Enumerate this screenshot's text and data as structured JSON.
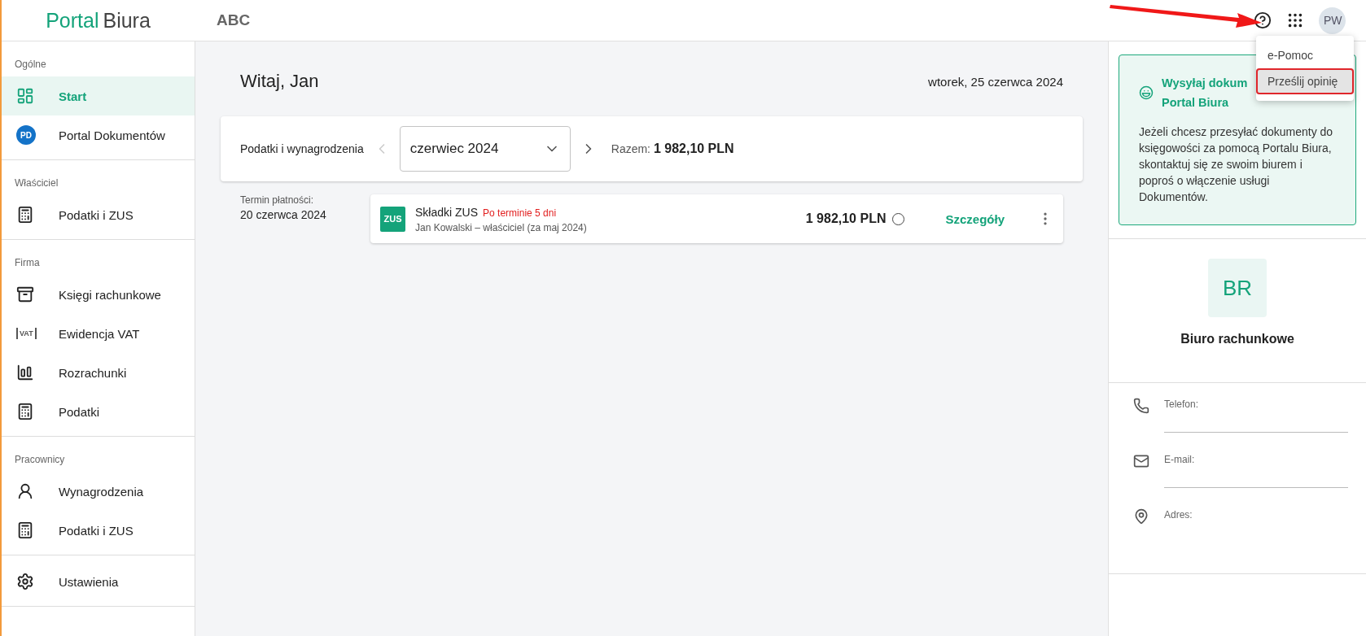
{
  "header": {
    "logo": {
      "part1": "Portal",
      "part2": "Biura"
    },
    "company": "ABC",
    "avatar": "PW"
  },
  "help_menu": {
    "items": [
      {
        "label": "e-Pomoc",
        "selected": false
      },
      {
        "label": "Prześlij opinię",
        "selected": true
      }
    ]
  },
  "sidebar": {
    "sections": [
      {
        "title": "Ogólne",
        "items": [
          {
            "label": "Start",
            "selected": true,
            "kind": "icon"
          },
          {
            "label": "Portal Dokumentów",
            "selected": false,
            "kind": "badge",
            "badge": "PD"
          }
        ]
      },
      {
        "title": "Właściciel",
        "items": [
          {
            "label": "Podatki i ZUS",
            "selected": false,
            "kind": "icon"
          }
        ]
      },
      {
        "title": "Firma",
        "items": [
          {
            "label": "Księgi rachunkowe",
            "selected": false,
            "kind": "icon"
          },
          {
            "label": "Ewidencja VAT",
            "selected": false,
            "kind": "tag",
            "badge": "VAT"
          },
          {
            "label": "Rozrachunki",
            "selected": false,
            "kind": "icon"
          },
          {
            "label": "Podatki",
            "selected": false,
            "kind": "icon"
          }
        ]
      },
      {
        "title": "Pracownicy",
        "items": [
          {
            "label": "Wynagrodzenia",
            "selected": false,
            "kind": "icon"
          },
          {
            "label": "Podatki i ZUS",
            "selected": false,
            "kind": "icon"
          }
        ]
      },
      {
        "items": [
          {
            "label": "Ustawienia",
            "selected": false,
            "kind": "icon"
          }
        ]
      }
    ]
  },
  "main": {
    "greeting": "Witaj, Jan",
    "date": "wtorek, 25 czerwca 2024",
    "filter": {
      "label": "Podatki i wynagrodzenia",
      "period": "czerwiec 2024",
      "total_label": "Razem:",
      "total": "1 982,10 PLN"
    },
    "payments": [
      {
        "due_label": "Termin płatności:",
        "due_date": "20 czerwca 2024",
        "badge": "ZUS",
        "title": "Składki ZUS",
        "status": "Po terminie 5 dni",
        "subtitle": "Jan Kowalski – właściciel (za maj 2024)",
        "amount": "1 982,10 PLN",
        "paid": false,
        "action": "Szczegóły"
      }
    ]
  },
  "right_panel": {
    "banner": {
      "title_lines": [
        "Wysyłaj dokum",
        "Portal Biura"
      ],
      "text": "Jeżeli chcesz przesyłać dokumenty do księgowości za pomocą Portalu Biura, skontaktuj się ze swoim biurem i poproś o włączenie usługi Dokumentów."
    },
    "office": {
      "initials": "BR",
      "name": "Biuro rachunkowe"
    },
    "contacts": [
      {
        "label": "Telefon:",
        "kind": "phone"
      },
      {
        "label": "E-mail:",
        "kind": "email"
      },
      {
        "label": "Adres:",
        "kind": "address"
      }
    ]
  }
}
